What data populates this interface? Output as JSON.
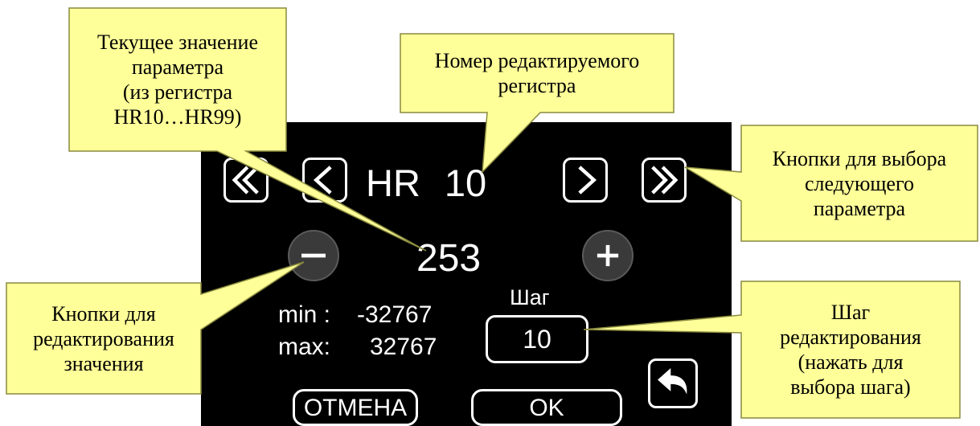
{
  "screen": {
    "register_prefix": "HR",
    "register_number": "10",
    "value": "253",
    "min_label": "min :",
    "min_value": "-32767",
    "max_label": "max:",
    "max_value": "32767",
    "step_title": "Шаг",
    "step_value": "10",
    "cancel_label": "ОТМЕНА",
    "ok_label": "OK",
    "icons": {
      "first": "double-chevron-left-icon",
      "prev": "chevron-left-icon",
      "next": "chevron-right-icon",
      "last": "double-chevron-right-icon",
      "minus": "minus-icon",
      "plus": "plus-icon",
      "back": "back-arrow-icon"
    }
  },
  "callouts": {
    "current_value": [
      "Текущее значение",
      "параметра",
      "(из регистра",
      "HR10…HR99)"
    ],
    "register_number": [
      "Номер редактируемого",
      "регистра"
    ],
    "next_param": [
      "Кнопки для выбора",
      "следующего",
      "параметра"
    ],
    "edit_buttons": [
      "Кнопки для",
      "редактирования",
      "значения"
    ],
    "step": [
      "Шаг",
      "редактирования",
      "(нажать для",
      "выбора шага)"
    ]
  },
  "colors": {
    "callout_fill": "#ffff99",
    "callout_stroke": "#8a8a40",
    "screen_bg": "#000000",
    "round_button": "#3a3a3a"
  }
}
